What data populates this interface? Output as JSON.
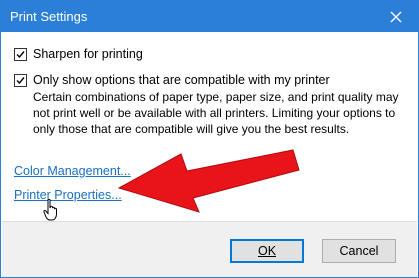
{
  "window": {
    "title": "Print Settings",
    "accent_color": "#2b7fd6"
  },
  "options": {
    "sharpen": {
      "label": "Sharpen for printing",
      "checked": true
    },
    "compatible": {
      "label": "Only show options that are compatible with my printer",
      "checked": true,
      "description": "Certain combinations of paper type, paper size, and print quality may not print well or be available with all printers.  Limiting your options to only those that are compatible will give you the best results."
    }
  },
  "links": {
    "color_management": "Color Management...",
    "printer_properties": "Printer Properties..."
  },
  "buttons": {
    "ok": "OK",
    "cancel": "Cancel"
  },
  "annotations": {
    "arrow_color": "#e8141a",
    "arrow_icon": "red-arrow-icon",
    "cursor_icon": "hand-pointer-icon"
  }
}
